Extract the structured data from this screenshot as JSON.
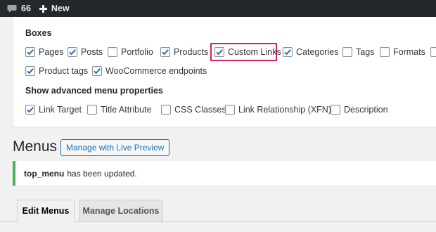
{
  "adminbar": {
    "comments_count": "66",
    "new_label": "New"
  },
  "screen_options": {
    "boxes_title": "Boxes",
    "boxes": [
      {
        "label": "Pages",
        "checked": true
      },
      {
        "label": "Posts",
        "checked": true
      },
      {
        "label": "Portfolio",
        "checked": false
      },
      {
        "label": "Products",
        "checked": true
      },
      {
        "label": "Custom Links",
        "checked": true,
        "highlighted": true
      },
      {
        "label": "Categories",
        "checked": true
      },
      {
        "label": "Tags",
        "checked": false
      },
      {
        "label": "Formats",
        "checked": false
      },
      {
        "label": "",
        "checked": false
      },
      {
        "label": "Product tags",
        "checked": true
      },
      {
        "label": "WooCommerce endpoints",
        "checked": true
      }
    ],
    "advanced_title": "Show advanced menu properties",
    "advanced": [
      {
        "label": "Link Target",
        "checked": true
      },
      {
        "label": "Title Attribute",
        "checked": false
      },
      {
        "label": "CSS Classes",
        "checked": false
      },
      {
        "label": "Link Relationship (XFN)",
        "checked": false
      },
      {
        "label": "Description",
        "checked": false
      }
    ]
  },
  "page": {
    "title": "Menus",
    "live_preview_button": "Manage with Live Preview"
  },
  "notice": {
    "menu_name": "top_menu",
    "message": "has been updated."
  },
  "tabs": [
    {
      "label": "Edit Menus",
      "active": true
    },
    {
      "label": "Manage Locations",
      "active": false
    }
  ],
  "colors": {
    "highlight": "#d4245a",
    "notice_success": "#46b450",
    "link": "#2271b1"
  }
}
